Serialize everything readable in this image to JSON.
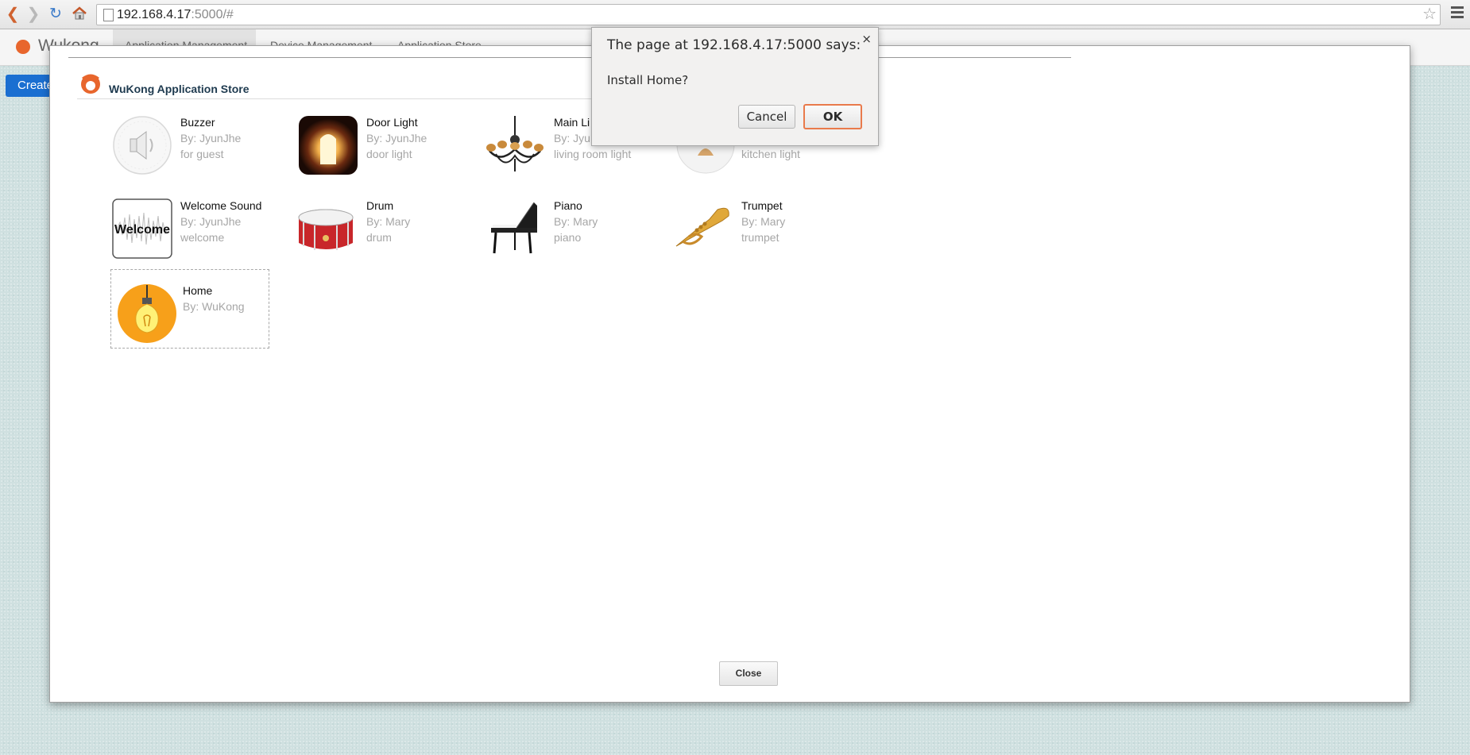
{
  "browser": {
    "url_host": "192.168.4.17",
    "url_rest": ":5000/#"
  },
  "app": {
    "brand": "Wukong",
    "tabs": [
      "Application Management",
      "Device Management",
      "Application Store"
    ],
    "create_button": "Create"
  },
  "store": {
    "title": "WuKong Application Store",
    "close_label": "Close",
    "apps": [
      {
        "name": "Buzzer",
        "author": "By: JyunJhe",
        "desc": "for guest",
        "icon": "speaker-icon"
      },
      {
        "name": "Door Light",
        "author": "By: JyunJhe",
        "desc": "door light",
        "icon": "doorway-light-icon"
      },
      {
        "name": "Main Li",
        "author": "By: Jyu",
        "desc": "living room light",
        "icon": "chandelier-icon"
      },
      {
        "name": "",
        "author": "",
        "desc": "kitchen light",
        "icon": "ceiling-lamp-icon"
      },
      {
        "name": "Welcome Sound",
        "author": "By: JyunJhe",
        "desc": "welcome",
        "icon": "welcome-waveform-icon"
      },
      {
        "name": "Drum",
        "author": "By: Mary",
        "desc": "drum",
        "icon": "drum-icon"
      },
      {
        "name": "Piano",
        "author": "By: Mary",
        "desc": "piano",
        "icon": "piano-icon"
      },
      {
        "name": "Trumpet",
        "author": "By: Mary",
        "desc": "trumpet",
        "icon": "trumpet-icon"
      },
      {
        "name": "Home",
        "author": "By: WuKong",
        "desc": "",
        "icon": "light-bulb-icon"
      }
    ]
  },
  "alert": {
    "title": "The page at 192.168.4.17:5000 says:",
    "message": "Install Home?",
    "cancel_label": "Cancel",
    "ok_label": "OK",
    "close_glyph": "×"
  }
}
